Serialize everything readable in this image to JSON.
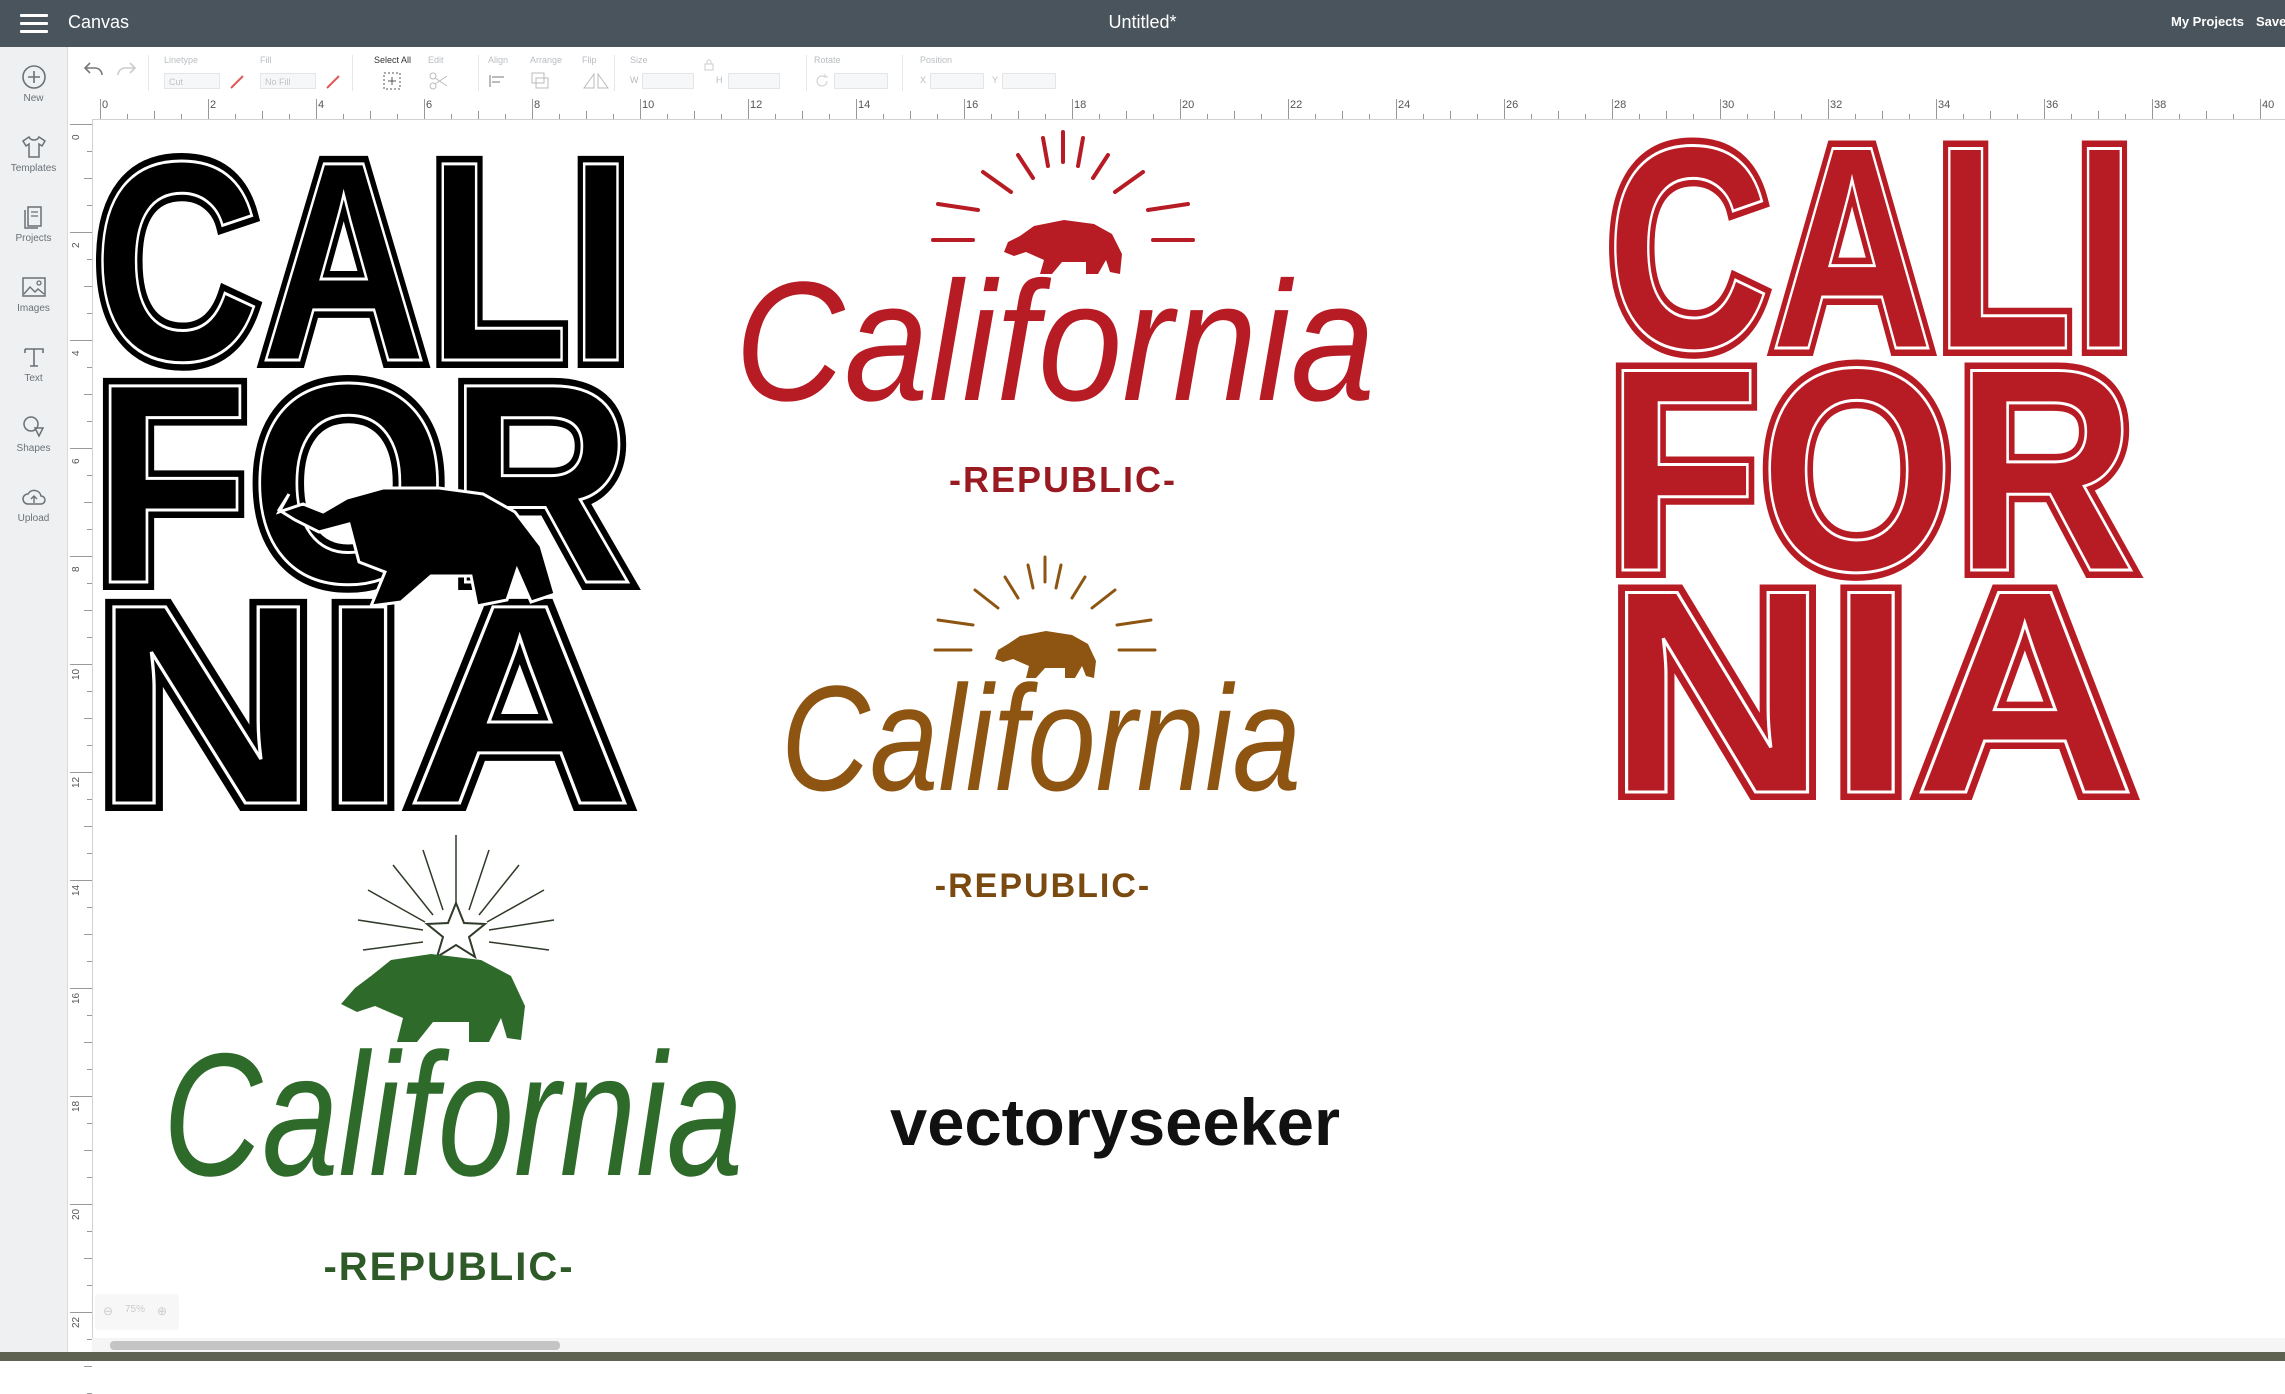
{
  "header": {
    "app_title": "Canvas",
    "doc_title": "Untitled*",
    "my_projects": "My Projects",
    "save": "Save"
  },
  "sidebar": {
    "items": [
      {
        "label": "New",
        "icon": "plus-circle-icon"
      },
      {
        "label": "Templates",
        "icon": "shirt-icon"
      },
      {
        "label": "Projects",
        "icon": "projects-icon"
      },
      {
        "label": "Images",
        "icon": "image-icon"
      },
      {
        "label": "Text",
        "icon": "text-icon"
      },
      {
        "label": "Shapes",
        "icon": "shapes-icon"
      },
      {
        "label": "Upload",
        "icon": "upload-cloud-icon"
      }
    ]
  },
  "toolbar": {
    "linetype_label": "Linetype",
    "linetype_value": "Cut",
    "fill_label": "Fill",
    "fill_value": "No Fill",
    "select_all_label": "Select All",
    "edit_label": "Edit",
    "align_label": "Align",
    "arrange_label": "Arrange",
    "flip_label": "Flip",
    "size_label": "Size",
    "w_label": "W",
    "h_label": "H",
    "rotate_label": "Rotate",
    "position_label": "Position",
    "x_label": "X",
    "y_label": "Y"
  },
  "ruler": {
    "top": [
      "0",
      "2",
      "4",
      "6",
      "8",
      "10",
      "12",
      "14",
      "16",
      "18",
      "20",
      "22",
      "24",
      "26",
      "28",
      "30",
      "32",
      "34",
      "36",
      "38",
      "40"
    ],
    "left": [
      "0",
      "2",
      "4",
      "6",
      "8",
      "10",
      "12",
      "14",
      "16",
      "18",
      "20",
      "22"
    ]
  },
  "designs": {
    "black_block": {
      "line1": "CALI",
      "line2": "FOR",
      "line3": "NIA"
    },
    "red_script": {
      "word": "California",
      "sub": "-REPUBLIC-"
    },
    "brown_script": {
      "word": "California",
      "sub": "-REPUBLIC-"
    },
    "green_script": {
      "word": "California",
      "sub": "-REPUBLIC-"
    },
    "watermark": "vectoryseeker",
    "red_block": {
      "line1": "CALI",
      "line2": "FOR",
      "line3": "NIA"
    }
  },
  "zoom": {
    "value": "75%"
  },
  "colors": {
    "red": "#b71c25",
    "brown": "#8e5512",
    "green": "#2e6a2a",
    "black": "#000000",
    "topbar": "#4a545c"
  }
}
